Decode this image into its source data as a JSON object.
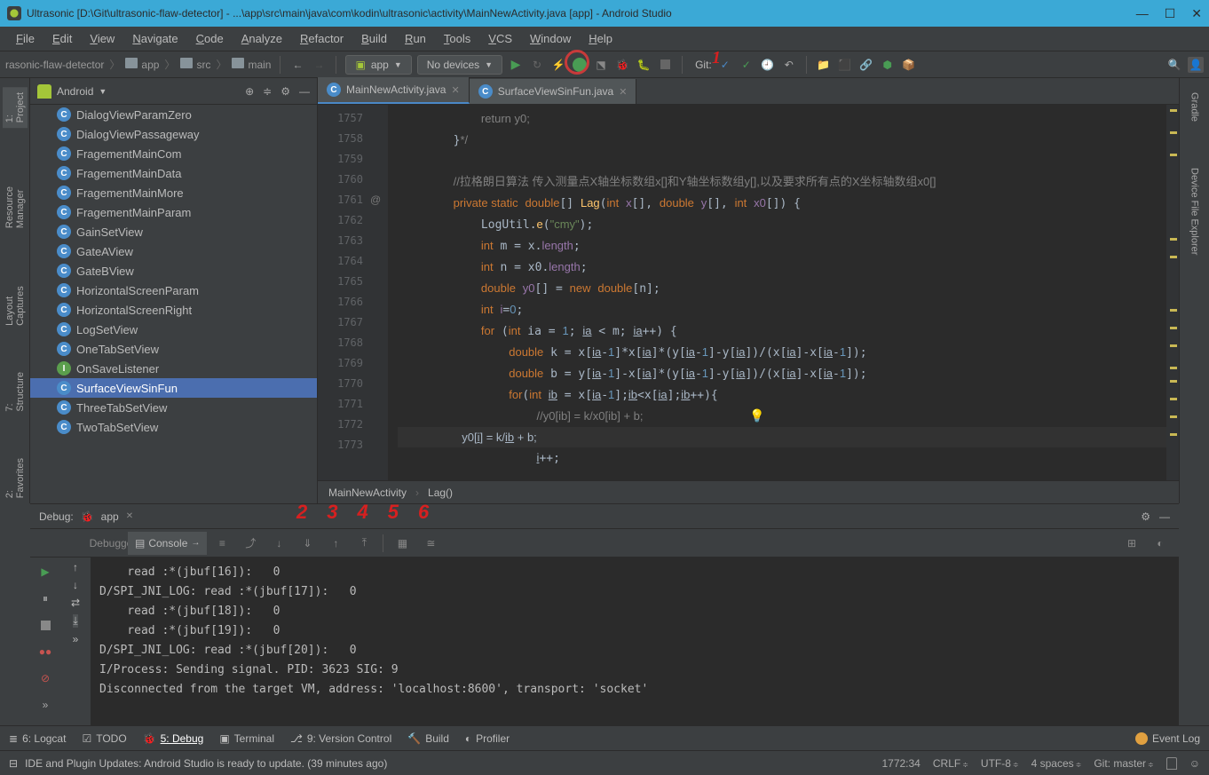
{
  "title": "Ultrasonic [D:\\Git\\ultrasonic-flaw-detector] - ...\\app\\src\\main\\java\\com\\kodin\\ultrasonic\\activity\\MainNewActivity.java [app] - Android Studio",
  "wincontrols": {
    "min": "—",
    "max": "☐",
    "close": "✕"
  },
  "menu": [
    "File",
    "Edit",
    "View",
    "Navigate",
    "Code",
    "Analyze",
    "Refactor",
    "Build",
    "Run",
    "Tools",
    "VCS",
    "Window",
    "Help"
  ],
  "breadcrumb": [
    "rasonic-flaw-detector",
    "app",
    "src",
    "main"
  ],
  "run_config": "app",
  "device": "No devices",
  "git_label": "Git:",
  "annotations": {
    "one": "1",
    "nums": [
      "2",
      "3",
      "4",
      "5",
      "6"
    ]
  },
  "sidebar_left": [
    "1: Project",
    "Resource Manager",
    "Layout Captures",
    "7: Structure",
    "2: Favorites"
  ],
  "sidebar_right": [
    "Gradle",
    "Device File Explorer"
  ],
  "project_header": "Android",
  "tree": [
    {
      "label": "DialogViewParamZero",
      "icon": "class"
    },
    {
      "label": "DialogViewPassageway",
      "icon": "class"
    },
    {
      "label": "FragementMainCom",
      "icon": "class"
    },
    {
      "label": "FragementMainData",
      "icon": "class"
    },
    {
      "label": "FragementMainMore",
      "icon": "class"
    },
    {
      "label": "FragementMainParam",
      "icon": "class"
    },
    {
      "label": "GainSetView",
      "icon": "class"
    },
    {
      "label": "GateAView",
      "icon": "class"
    },
    {
      "label": "GateBView",
      "icon": "class"
    },
    {
      "label": "HorizontalScreenParam",
      "icon": "class"
    },
    {
      "label": "HorizontalScreenRight",
      "icon": "class"
    },
    {
      "label": "LogSetView",
      "icon": "class"
    },
    {
      "label": "OneTabSetView",
      "icon": "class"
    },
    {
      "label": "OnSaveListener",
      "icon": "iface"
    },
    {
      "label": "SurfaceViewSinFun",
      "icon": "class",
      "selected": true
    },
    {
      "label": "ThreeTabSetView",
      "icon": "class"
    },
    {
      "label": "TwoTabSetView",
      "icon": "class"
    }
  ],
  "tabs": [
    {
      "label": "MainNewActivity.java",
      "active": true
    },
    {
      "label": "SurfaceViewSinFun.java",
      "active": false
    }
  ],
  "line_start": 1757,
  "line_count": 17,
  "gutter_anno": {
    "line": 1761,
    "sym": "@"
  },
  "editor_crumb": [
    "MainNewActivity",
    "Lag()"
  ],
  "debug_title": "Debug:",
  "debug_app": "app",
  "debug_tabs": {
    "debugger": "Debugger",
    "console": "Console"
  },
  "console_lines": [
    "    read :*(jbuf[16]):   0",
    "D/SPI_JNI_LOG: read :*(jbuf[17]):   0",
    "    read :*(jbuf[18]):   0",
    "    read :*(jbuf[19]):   0",
    "D/SPI_JNI_LOG: read :*(jbuf[20]):   0",
    "I/Process: Sending signal. PID: 3623 SIG: 9",
    "Disconnected from the target VM, address: 'localhost:8600', transport: 'socket'"
  ],
  "bottom_tabs": [
    "6: Logcat",
    "TODO",
    "5: Debug",
    "Terminal",
    "9: Version Control",
    "Build",
    "Profiler"
  ],
  "event_log": "Event Log",
  "status_msg": "IDE and Plugin Updates: Android Studio is ready to update. (39 minutes ago)",
  "status_right": {
    "pos": "1772:34",
    "eol": "CRLF",
    "enc": "UTF-8",
    "indent": "4 spaces",
    "branch": "Git: master"
  }
}
